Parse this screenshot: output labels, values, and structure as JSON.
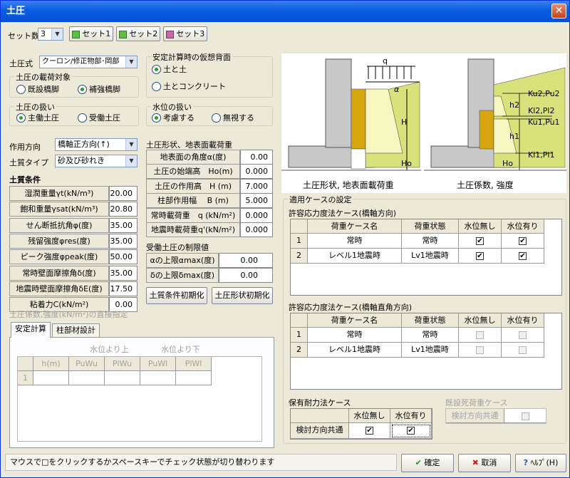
{
  "window": {
    "title": "土圧"
  },
  "sets": {
    "label": "セット数",
    "value": "3",
    "buttons": [
      "セット1",
      "セット2",
      "セット3"
    ],
    "colors": [
      "#5bc043",
      "#5bc043",
      "#cc66aa"
    ]
  },
  "earth_pressure": {
    "formula_label": "土圧式",
    "formula_value": "クーロン/修正物部･岡部",
    "load_target_title": "土圧の載荷対象",
    "load_target_options": [
      "既設橋脚",
      "補強橋脚"
    ],
    "handling_title": "土圧の扱い",
    "handling_options": [
      "主働土圧",
      "受働土圧"
    ],
    "direction_label": "作用方向",
    "direction_value": "橋軸正方向(↑)",
    "soil_type_label": "土質タイプ",
    "soil_type_value": "砂及び砂れき"
  },
  "virtual_back": {
    "title": "安定計算時の仮想背面",
    "options": [
      "土と土",
      "土とコンクリート"
    ]
  },
  "water": {
    "title": "水位の扱い",
    "options": [
      "考慮する",
      "無視する"
    ]
  },
  "soil_conditions": {
    "title": "土質条件",
    "rows": [
      {
        "label": "湿潤重量γt(kN/m³)",
        "value": "20.00"
      },
      {
        "label": "飽和重量γsat(kN/m³)",
        "value": "20.80"
      },
      {
        "label": "せん断抵抗角φ(度)",
        "value": "35.00"
      },
      {
        "label": "残留強度φres(度)",
        "value": "35.00"
      },
      {
        "label": "ピーク強度φpeak(度)",
        "value": "50.00"
      },
      {
        "label": "常時壁面摩擦角δ(度)",
        "value": "35.00"
      },
      {
        "label": "地震時壁面摩擦角δE(度)",
        "value": "17.50"
      },
      {
        "label": "粘着力C(kN/m²)",
        "value": "0.00"
      }
    ]
  },
  "shape": {
    "title": "土圧形状、地表面載荷重",
    "rows": [
      {
        "label": "地表面の角度α(度)",
        "value": "0.00"
      },
      {
        "label": "土圧の始端高　Ho(m)",
        "value": "0.000"
      },
      {
        "label": "土圧の作用高　H (m)",
        "value": "7.000"
      },
      {
        "label": "柱部作用幅　 B (m)",
        "value": "5.000"
      },
      {
        "label": "常時載荷重　q (kN/m²)",
        "value": "0.000"
      },
      {
        "label": "地震時載荷重q'(kN/m²)",
        "value": "0.000"
      }
    ]
  },
  "passive_limits": {
    "title": "受働土圧の制限値",
    "rows": [
      {
        "label": "αの上限αmax(度)",
        "value": "0.00"
      },
      {
        "label": "δの上限δmax(度)",
        "value": "0.00"
      }
    ]
  },
  "init_buttons": {
    "soil": "土質条件初期化",
    "shape": "土圧形状初期化"
  },
  "direct": {
    "title": "土圧係数,強度(kN/m²)の直接指定",
    "tabs": [
      "安定計算",
      "柱部材設計"
    ],
    "group_up": "水位より上",
    "group_down": "水位より下",
    "cols": [
      "h(m)",
      "PuWu",
      "PlWu",
      "PuWl",
      "PlWl"
    ],
    "row_no": "1"
  },
  "figures": {
    "left_caption": "土圧形状, 地表面載荷重",
    "right_caption": "土圧係数, 強度",
    "left_labels": [
      "q",
      "α",
      "H",
      "Ho"
    ],
    "right_labels": [
      "Ku2,Pu2",
      "h2",
      "Kl2,Pl2",
      "Ku1,Pu1",
      "h1",
      "Kl1,Pl1",
      "Ho"
    ]
  },
  "cases": {
    "title": "適用ケースの設定",
    "allowable_axis": {
      "title": "許容応力度法ケース(橋軸方向)",
      "headers": [
        "荷重ケース名",
        "荷重状態",
        "水位無し",
        "水位有り"
      ],
      "rows": [
        {
          "no": "1",
          "name": "常時",
          "state": "常時"
        },
        {
          "no": "2",
          "name": "レベル1地震時",
          "state": "Lv1地震時"
        }
      ]
    },
    "allowable_perp": {
      "title": "許容応力度法ケース(橋軸直角方向)",
      "headers": [
        "荷重ケース名",
        "荷重状態",
        "水位無し",
        "水位有り"
      ],
      "rows": [
        {
          "no": "1",
          "name": "常時",
          "state": "常時"
        },
        {
          "no": "2",
          "name": "レベル1地震時",
          "state": "Lv1地震時"
        }
      ]
    },
    "ultimate": {
      "title": "保有耐力法ケース",
      "headers": [
        "水位無し",
        "水位有り"
      ],
      "row_label": "検討方向共通"
    },
    "existing_dead": {
      "title": "既設死荷重ケース",
      "row_label": "検討方向共通"
    }
  },
  "status": {
    "text": "マウスで□をクリックするかスペースキーでチェック状態が切り替わります"
  },
  "footer": {
    "ok": "確定",
    "cancel": "取消",
    "help": "ﾍﾙﾌﾟ(H)"
  }
}
